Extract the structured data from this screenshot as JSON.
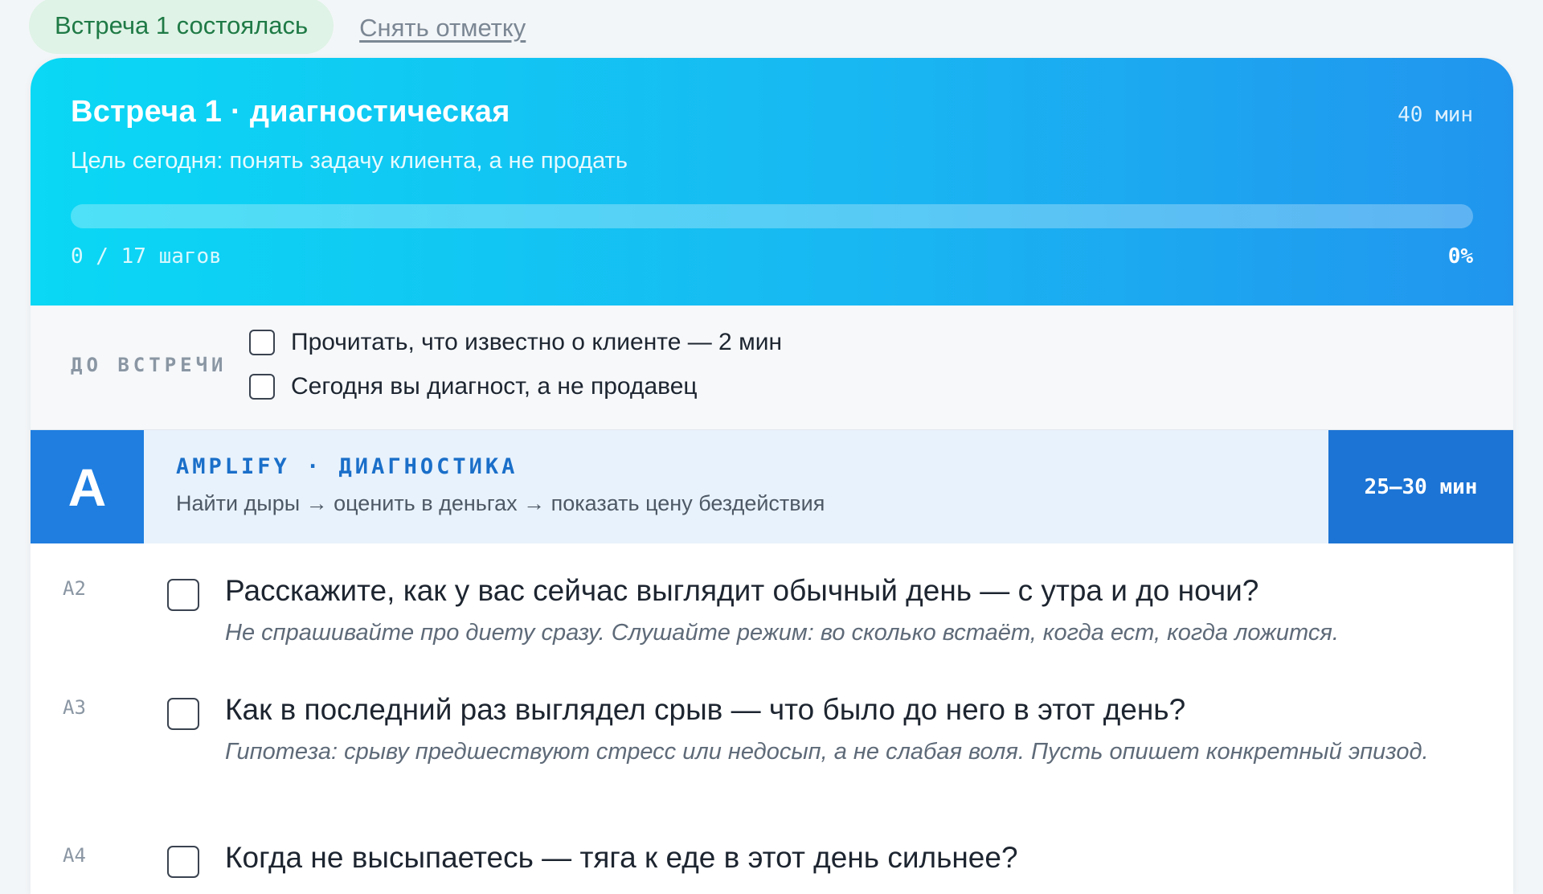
{
  "status": {
    "met_label": "Встреча 1 состоялась",
    "unmark_label": "Снять отметку"
  },
  "meeting": {
    "title": "Встреча 1 · диагностическая",
    "duration": "40 мин",
    "goal": "Цель сегодня: понять задачу клиента, а не продать",
    "progress": {
      "steps_text": "0 / 17 шагов",
      "percent_text": "0%",
      "percent": 0
    }
  },
  "before_meeting": {
    "label": "ДО ВСТРЕЧИ",
    "items": [
      "Прочитать, что известно о клиенте — 2 мин",
      "Сегодня вы диагност, а не продавец"
    ]
  },
  "section": {
    "letter": "A",
    "name": "AMPLIFY · ДИАГНОСТИКА",
    "description": "Найти дыры → оценить в деньгах → показать цену бездействия",
    "time": "25–30 мин"
  },
  "questions": [
    {
      "code": "A2",
      "text": "Расскажите, как у вас сейчас выглядит обычный день — с утра и до ночи?",
      "hint": "Не спрашивайте про диету сразу. Слушайте режим: во сколько встаёт, когда ест, когда ложится."
    },
    {
      "code": "A3",
      "text": "Как в последний раз выглядел срыв — что было до него в этот день?",
      "hint": "Гипотеза: срыву предшествуют стресс или недосып, а не слабая воля. Пусть опишет конкретный эпизод."
    },
    {
      "code": "A4",
      "text": "Когда не высыпаетесь — тяга к еде в этот день сильнее?",
      "hint": ""
    }
  ]
}
